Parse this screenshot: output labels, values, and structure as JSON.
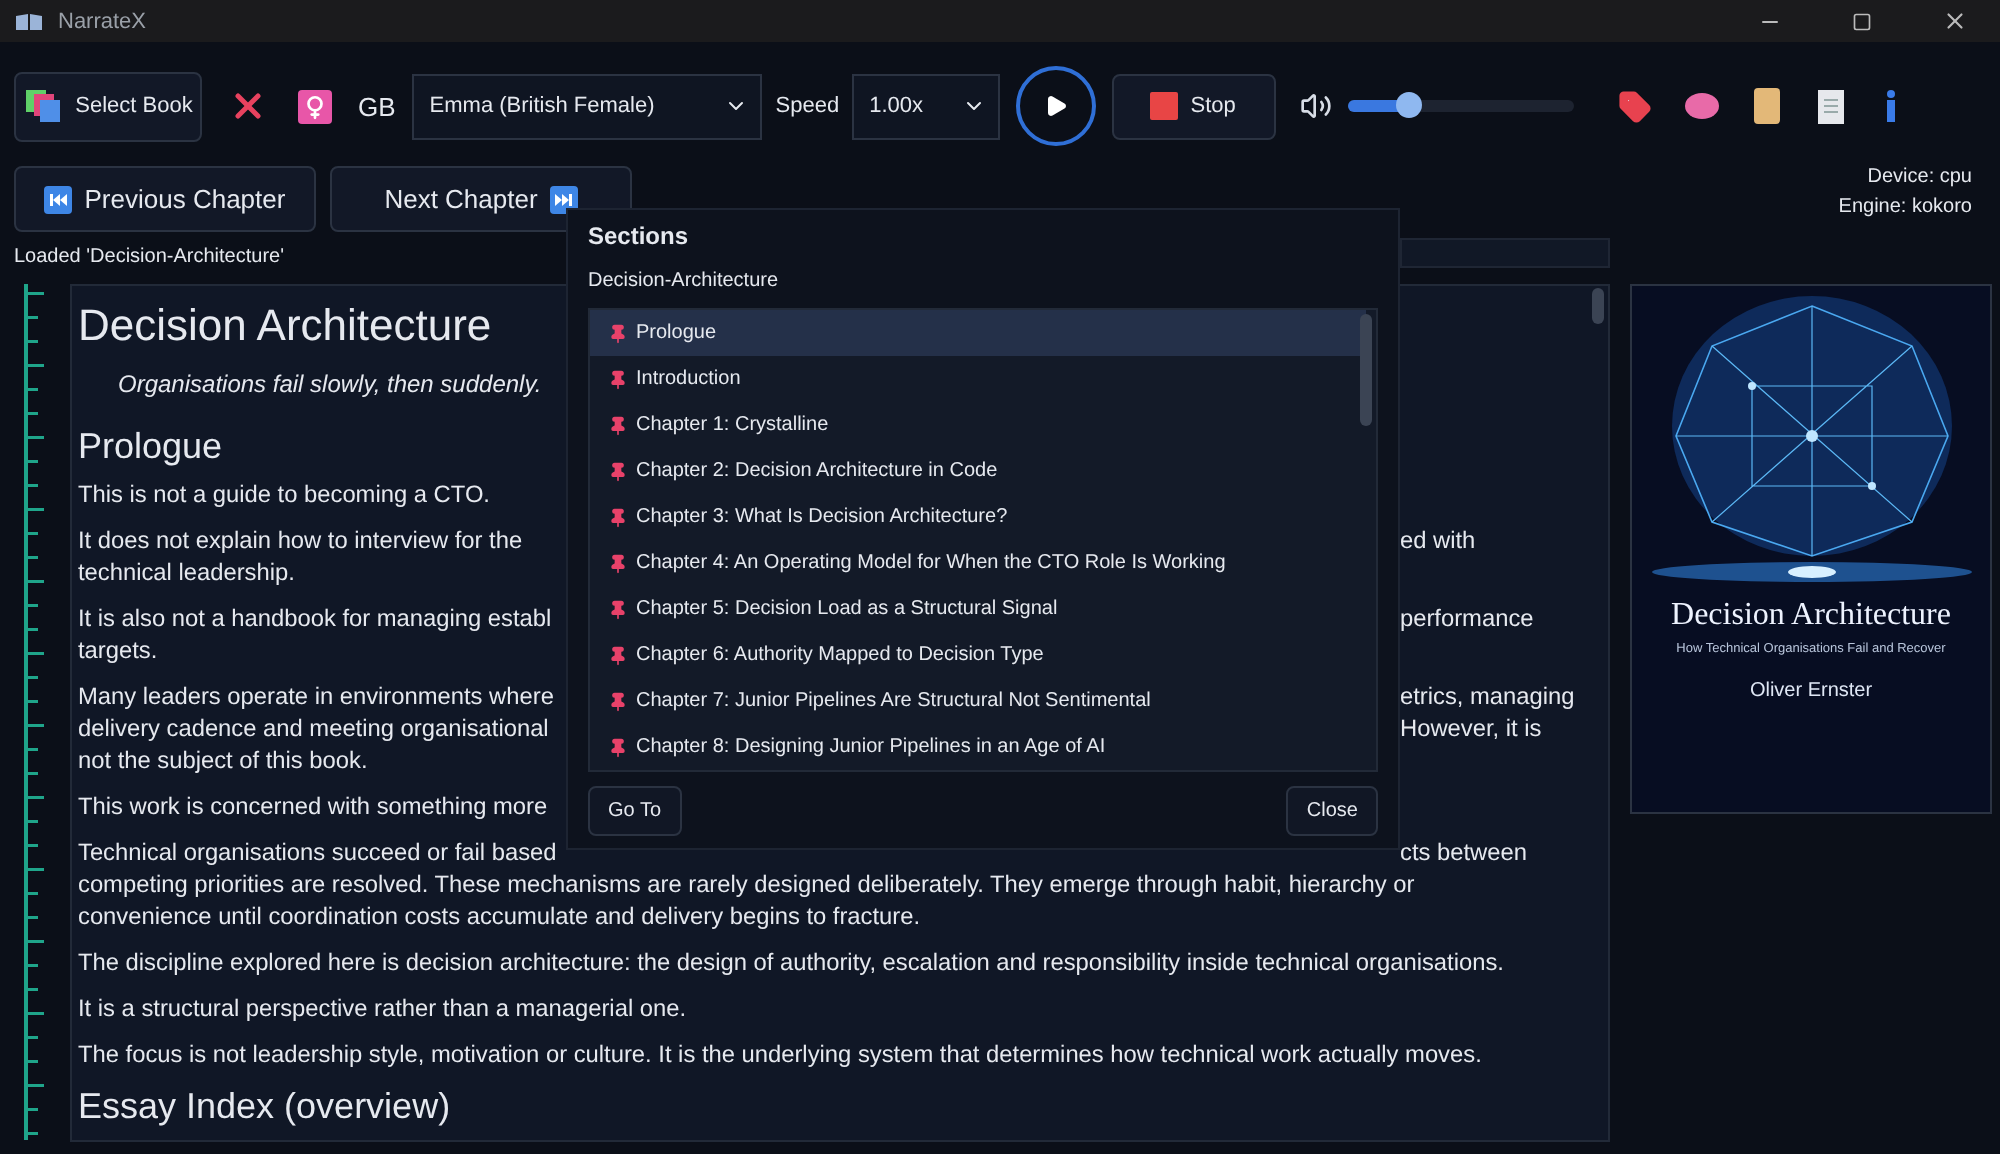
{
  "window": {
    "title": "NarrateX"
  },
  "toolbar": {
    "select_book": "Select Book",
    "language": "GB",
    "voice": "Emma (British Female)",
    "speed_label": "Speed",
    "speed": "1.00x",
    "stop": "Stop",
    "volume": {
      "level": 0.27
    }
  },
  "navigation": {
    "previous": "Previous Chapter",
    "next": "Next Chapter"
  },
  "engine_info": [
    "Device: cpu",
    "Engine: kokoro"
  ],
  "status": "Loaded 'Decision-Architecture'",
  "progress": {
    "level": 0
  },
  "document": {
    "blocks": [
      {
        "kind": "title",
        "text": "Decision Architecture"
      },
      {
        "kind": "subtitle",
        "text": "Organisations fail slowly, then suddenly."
      },
      {
        "kind": "heading",
        "text": "Prologue"
      },
      {
        "kind": "paragraph",
        "lines": [
          {
            "text": "This is not a guide to becoming a CTO."
          }
        ]
      },
      {
        "kind": "paragraph",
        "lines": [
          {
            "text": "It does not explain how to interview for the",
            "continued": "ed with"
          },
          {
            "text": "technical leadership."
          }
        ]
      },
      {
        "kind": "paragraph",
        "lines": [
          {
            "text": "It is also not a handbook for managing establ",
            "continued": "performance"
          },
          {
            "text": "targets."
          }
        ]
      },
      {
        "kind": "paragraph",
        "lines": [
          {
            "text": "Many leaders operate in environments where",
            "continued": "etrics, managing"
          },
          {
            "text": "delivery cadence and meeting organisational",
            "continued": "However, it is"
          },
          {
            "text": "not the subject of this book."
          }
        ]
      },
      {
        "kind": "paragraph",
        "lines": [
          {
            "text": "This work is concerned with something more"
          }
        ]
      },
      {
        "kind": "paragraph",
        "lines": [
          {
            "text": "Technical organisations succeed or fail based",
            "continued": "cts between"
          },
          {
            "text": "competing priorities are resolved. These mechanisms are rarely designed deliberately. They emerge through habit, hierarchy or"
          },
          {
            "text": "convenience until coordination costs accumulate and delivery begins to fracture."
          }
        ]
      },
      {
        "kind": "paragraph",
        "lines": [
          {
            "text": "The discipline explored here is decision architecture: the design of authority, escalation and responsibility inside technical organisations."
          }
        ]
      },
      {
        "kind": "paragraph",
        "lines": [
          {
            "text": "It is a structural perspective rather than a managerial one."
          }
        ]
      },
      {
        "kind": "paragraph",
        "lines": [
          {
            "text": "The focus is not leadership style, motivation or culture. It is the underlying system that determines how technical work actually moves."
          }
        ]
      },
      {
        "kind": "heading",
        "text": "Essay Index (overview)"
      }
    ]
  },
  "cover": {
    "title": "Decision Architecture",
    "subtitle": "How Technical Organisations Fail and Recover",
    "author": "Oliver Ernster"
  },
  "sections_dialog": {
    "title": "Sections",
    "book": "Decision-Architecture",
    "items": [
      {
        "label": "Prologue",
        "selected": true
      },
      {
        "label": "Introduction",
        "selected": false
      },
      {
        "label": "Chapter 1: Crystalline",
        "selected": false
      },
      {
        "label": "Chapter 2: Decision Architecture in Code",
        "selected": false
      },
      {
        "label": "Chapter 3: What Is Decision Architecture?",
        "selected": false
      },
      {
        "label": "Chapter 4: An Operating Model for When the CTO Role Is Working",
        "selected": false
      },
      {
        "label": "Chapter 5: Decision Load as a Structural Signal",
        "selected": false
      },
      {
        "label": "Chapter 6: Authority Mapped to Decision Type",
        "selected": false
      },
      {
        "label": "Chapter 7: Junior Pipelines Are Structural Not Sentimental",
        "selected": false
      },
      {
        "label": "Chapter 8: Designing Junior Pipelines in an Age of AI",
        "selected": false
      }
    ],
    "buttons": [
      "Go To",
      "Close"
    ]
  }
}
